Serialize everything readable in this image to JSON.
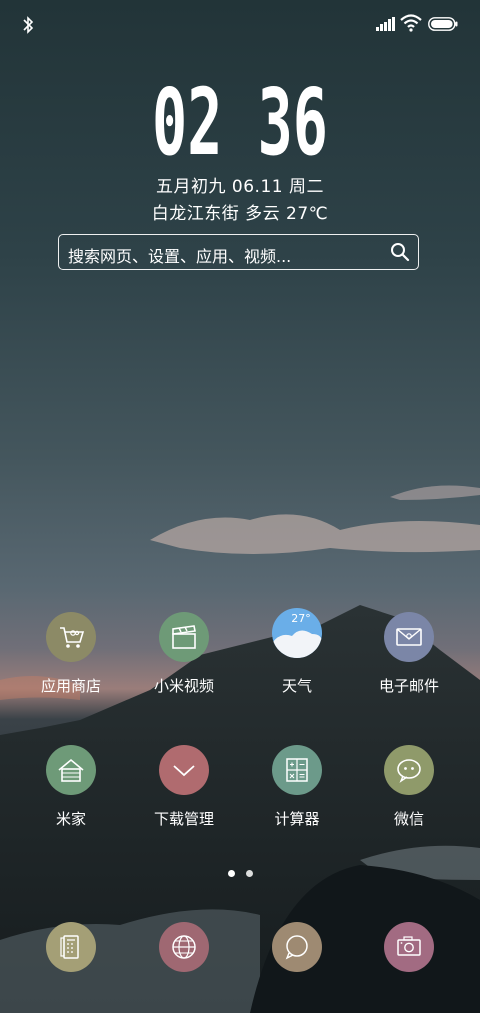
{
  "status_bar": {
    "icons": [
      "bluetooth-icon",
      "signal-icon",
      "wifi-icon",
      "battery-icon"
    ]
  },
  "clock": {
    "time": "02 36",
    "date": "五月初九  06.11 周二",
    "weather": "白龙江东街   多云   27℃"
  },
  "search": {
    "placeholder": "搜索网页、设置、应用、视频..."
  },
  "apps": [
    {
      "label": "应用商店",
      "color": "#8c8a66",
      "icon": "cart-icon"
    },
    {
      "label": "小米视频",
      "color": "#6e9a77",
      "icon": "clapperboard-icon"
    },
    {
      "label": "天气",
      "color": "#6aaee8",
      "icon": "weather-icon",
      "badge": "27°"
    },
    {
      "label": "电子邮件",
      "color": "#7b86a7",
      "icon": "mail-icon"
    },
    {
      "label": "米家",
      "color": "#6e9a78",
      "icon": "house-icon"
    },
    {
      "label": "下载管理",
      "color": "#b06b6f",
      "icon": "chevron-down-icon"
    },
    {
      "label": "计算器",
      "color": "#6c9a8a",
      "icon": "calculator-icon"
    },
    {
      "label": "微信",
      "color": "#8f9a6a",
      "icon": "chat-bubble-icon"
    }
  ],
  "dock": [
    {
      "color": "#a49f76",
      "icon": "phone-icon"
    },
    {
      "color": "#9f6872",
      "icon": "globe-icon"
    },
    {
      "color": "#9e8a72",
      "icon": "message-icon"
    },
    {
      "color": "#a26b82",
      "icon": "camera-icon"
    }
  ],
  "pager": {
    "pages": 2,
    "current": 1
  }
}
